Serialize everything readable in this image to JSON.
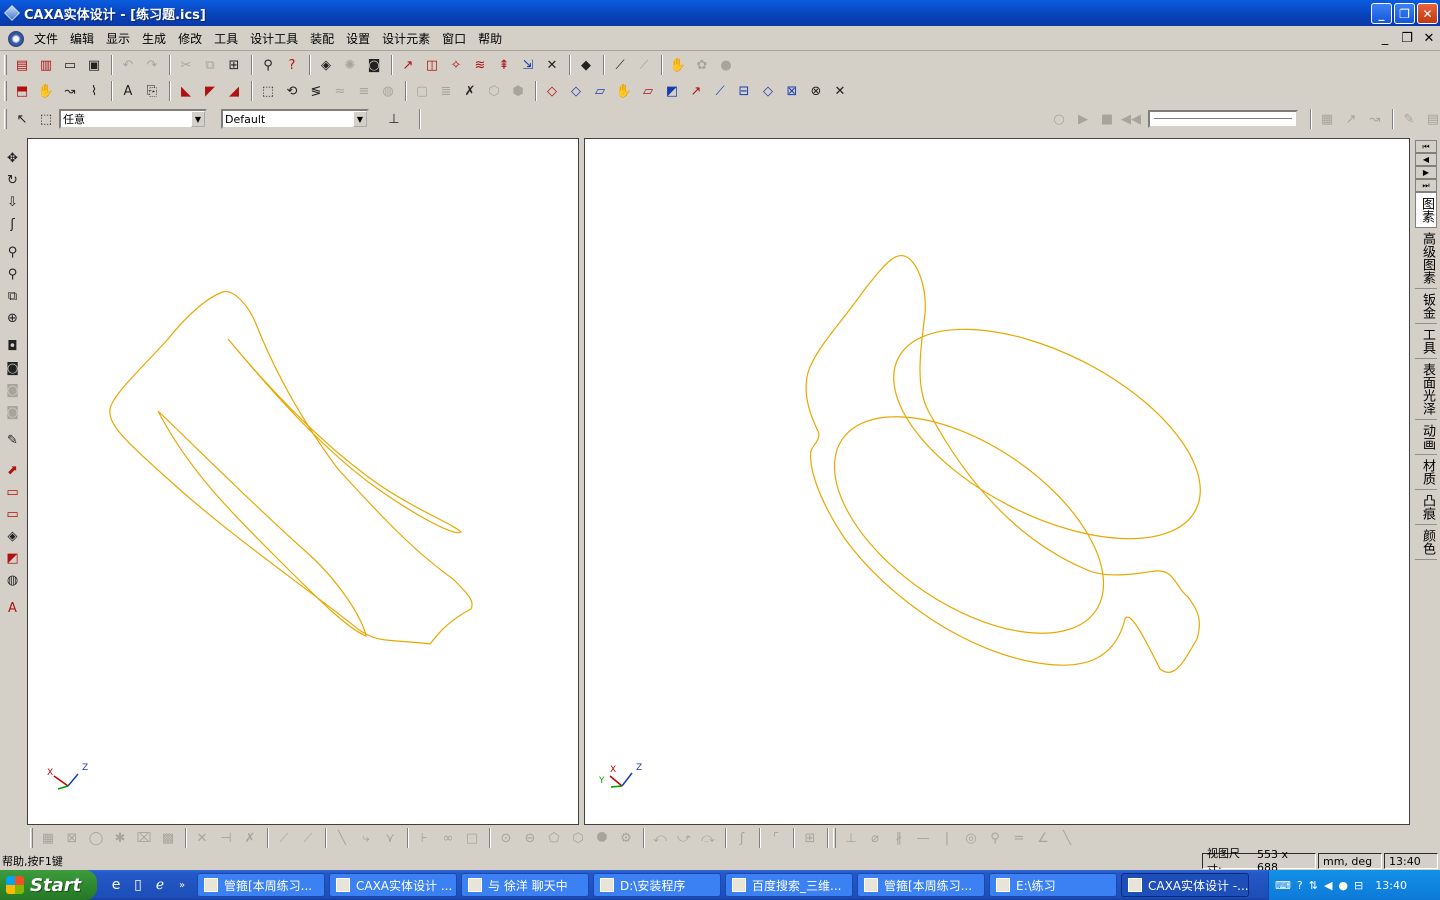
{
  "window": {
    "title": "CAXA实体设计 - [练习题.ics]",
    "min_glyph": "_",
    "max_glyph": "❐",
    "close_glyph": "✕"
  },
  "menu": {
    "items": [
      "文件",
      "编辑",
      "显示",
      "生成",
      "修改",
      "工具",
      "设计工具",
      "装配",
      "设置",
      "设计元素",
      "窗口",
      "帮助"
    ],
    "mdi_min": "_",
    "mdi_restore": "❐",
    "mdi_close": "✕"
  },
  "toolbar3": {
    "select_mode": "任意",
    "style": "Default"
  },
  "right_panel": {
    "tabs": [
      "图素",
      "高级图素",
      "钣金",
      "工具",
      "表面光泽",
      "动画",
      "材质",
      "凸痕",
      "颜色"
    ],
    "active_tab": "图素"
  },
  "viewports": {
    "left": {
      "axis_x": "X",
      "axis_z": "Z"
    },
    "right": {
      "axis_x": "X",
      "axis_y": "Y",
      "axis_z": "Z"
    },
    "wire_color": "#e8a800"
  },
  "status": {
    "help": "帮助,按F1键",
    "view_size_label": "视图尺寸:",
    "view_size_value": "553 x 688",
    "units": "mm, deg",
    "time": "13:40"
  },
  "taskbar": {
    "start": "Start",
    "tasks": [
      {
        "label": "管箍[本周练习..."
      },
      {
        "label": "CAXA实体设计 ..."
      },
      {
        "label": "与 徐洋 聊天中"
      },
      {
        "label": "D:\\安装程序"
      },
      {
        "label": "百度搜索_三维..."
      },
      {
        "label": "管箍[本周练习..."
      },
      {
        "label": "E:\\练习"
      },
      {
        "label": "CAXA实体设计 -..."
      }
    ],
    "active_index": 7,
    "clock": "13:40"
  }
}
